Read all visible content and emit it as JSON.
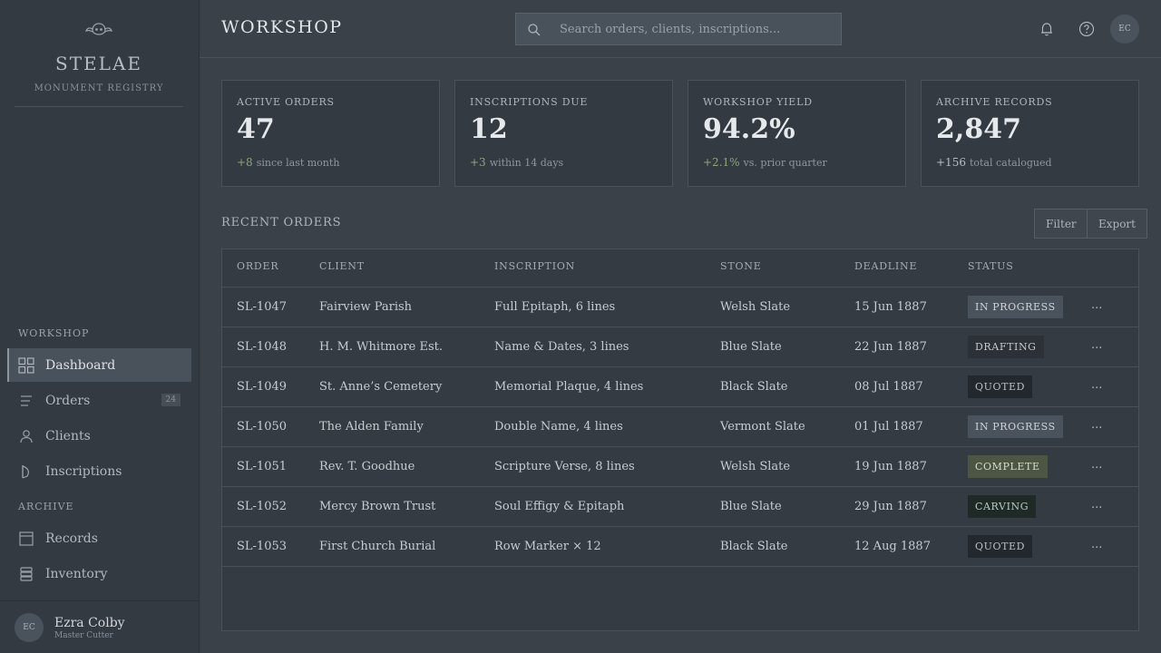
{
  "brand": {
    "name": "STELAE",
    "subtitle": "MONUMENT REGISTRY"
  },
  "sidebar": {
    "section_workshop": "WORKSHOP",
    "section_archive": "ARCHIVE",
    "items": [
      {
        "label": "Dashboard",
        "icon": "dashboard-grid-icon",
        "active": true
      },
      {
        "label": "Orders",
        "icon": "list-lines-icon",
        "badge": "24"
      },
      {
        "label": "Clients",
        "icon": "person-icon"
      },
      {
        "label": "Inscriptions",
        "icon": "chisel-icon"
      },
      {
        "label": "Records",
        "icon": "calendar-book-icon"
      },
      {
        "label": "Inventory",
        "icon": "stack-icon"
      }
    ],
    "user": {
      "initials": "EC",
      "name": "Ezra Colby",
      "role": "Master Cutter"
    }
  },
  "header": {
    "title": "WORKSHOP",
    "search_placeholder": "Search orders, clients, inscriptions...",
    "avatar_initials": "EC"
  },
  "stats": [
    {
      "label": "ACTIVE ORDERS",
      "value": "47",
      "delta": "+8",
      "note": "since last month",
      "tone": "positive"
    },
    {
      "label": "INSCRIPTIONS DUE",
      "value": "12",
      "delta": "+3",
      "note": "within 14 days",
      "tone": "positive"
    },
    {
      "label": "WORKSHOP YIELD",
      "value": "94.2%",
      "delta": "+2.1%",
      "note": "vs. prior quarter",
      "tone": "positive"
    },
    {
      "label": "ARCHIVE RECORDS",
      "value": "2,847",
      "delta": "+156",
      "note": "total catalogued",
      "tone": "neutral"
    }
  ],
  "orders": {
    "title": "RECENT ORDERS",
    "filter_label": "Filter",
    "export_label": "Export",
    "columns": [
      "ORDER",
      "CLIENT",
      "INSCRIPTION",
      "STONE",
      "DEADLINE",
      "STATUS"
    ],
    "rows": [
      {
        "order": "SL-1047",
        "client": "Fairview Parish",
        "inscription": "Full Epitaph, 6 lines",
        "stone": "Welsh Slate",
        "deadline": "15 Jun 1887",
        "status": "IN PROGRESS",
        "more": "..."
      },
      {
        "order": "SL-1048",
        "client": "H. M. Whitmore Est.",
        "inscription": "Name & Dates, 3 lines",
        "stone": "Blue Slate",
        "deadline": "22 Jun 1887",
        "status": "DRAFTING",
        "more": "..."
      },
      {
        "order": "SL-1049",
        "client": "St. Anne’s Cemetery",
        "inscription": "Memorial Plaque, 4 lines",
        "stone": "Black Slate",
        "deadline": "08 Jul 1887",
        "status": "QUOTED",
        "more": "..."
      },
      {
        "order": "SL-1050",
        "client": "The Alden Family",
        "inscription": "Double Name, 4 lines",
        "stone": "Vermont Slate",
        "deadline": "01 Jul 1887",
        "status": "IN PROGRESS",
        "more": "..."
      },
      {
        "order": "SL-1051",
        "client": "Rev. T. Goodhue",
        "inscription": "Scripture Verse, 8 lines",
        "stone": "Welsh Slate",
        "deadline": "19 Jun 1887",
        "status": "COMPLETE",
        "more": "..."
      },
      {
        "order": "SL-1052",
        "client": "Mercy Brown Trust",
        "inscription": "Soul Effigy & Epitaph",
        "stone": "Blue Slate",
        "deadline": "29 Jun 1887",
        "status": "CARVING",
        "more": "..."
      },
      {
        "order": "SL-1053",
        "client": "First Church Burial",
        "inscription": "Row Marker × 12",
        "stone": "Black Slate",
        "deadline": "12 Aug 1887",
        "status": "QUOTED",
        "more": "..."
      }
    ]
  },
  "status_colors": {
    "IN PROGRESS": {
      "bg": "#4a535c",
      "fg": "#cdd3d8"
    },
    "DRAFTING": {
      "bg": "#2b3137",
      "fg": "#c3c8cd"
    },
    "QUOTED": {
      "bg": "#22282d",
      "fg": "#b9bfc5"
    },
    "COMPLETE": {
      "bg": "#4d5643",
      "fg": "#d5dcc9"
    },
    "CARVING": {
      "bg": "#1f2a27",
      "fg": "#b8c9c0"
    }
  }
}
